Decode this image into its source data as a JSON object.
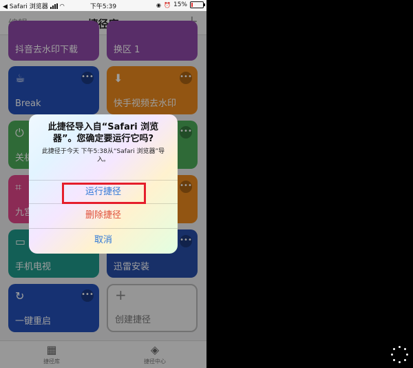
{
  "statusbar": {
    "carrier": "Safari 浏览器",
    "time": "下午5:39",
    "battery": "15%",
    "battery_level": 0.15
  },
  "navbar": {
    "edit": "编辑",
    "title": "捷径库",
    "add": "+"
  },
  "tiles": {
    "t1": {
      "label": "抖音去水印下载"
    },
    "t2": {
      "label": "换区 1"
    },
    "t3": {
      "label": "Break"
    },
    "t4": {
      "label": "快手视频去水印"
    },
    "t5": {
      "label": "关机"
    },
    "t7": {
      "label": "九宫"
    },
    "t9": {
      "label": "手机电视"
    },
    "t10": {
      "label": "迅雷安装"
    },
    "t11": {
      "label": "一键重启"
    },
    "t12": {
      "label": "创建捷径"
    },
    "more": "•••"
  },
  "alert": {
    "title": "此捷径导入自“Safari 浏览器”。您确定要运行它吗?",
    "message": "此捷径于今天 下午5:38从“Safari 浏览器”导入。",
    "run_label": "运行捷径",
    "delete_label": "删除捷径",
    "cancel_label": "取消"
  },
  "tabbar": {
    "library": "捷径库",
    "gallery": "捷径中心"
  },
  "colors": {
    "accent_blue": "#2f78d8",
    "destructive_red": "#e0503a",
    "highlight_red": "#e51e2b"
  },
  "icons": [
    "coffee-icon",
    "download-icon",
    "power-icon",
    "crop-icon",
    "tv-icon",
    "refresh-icon",
    "plus-icon",
    "grid-icon",
    "layers-icon",
    "spinner-icon"
  ]
}
